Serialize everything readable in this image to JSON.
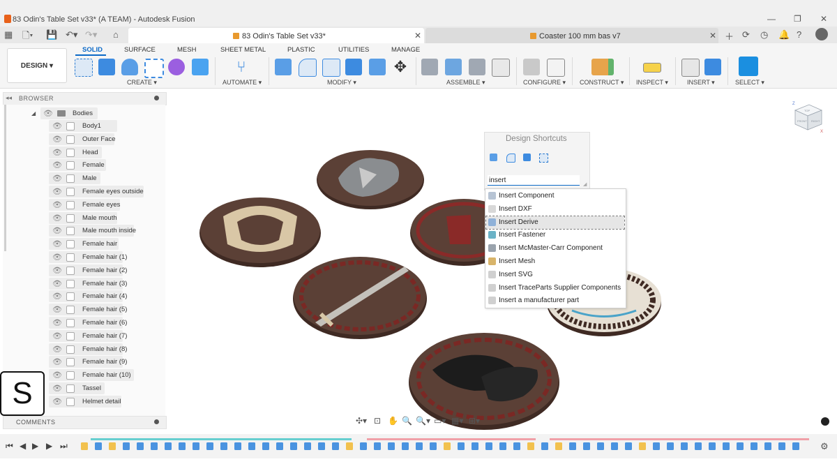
{
  "window": {
    "title": "83 Odin's Table Set v33* (A TEAM) - Autodesk Fusion"
  },
  "tabs": [
    {
      "label": "83 Odin's Table Set v33*",
      "active": true
    },
    {
      "label": "Coaster 100 mm bas v7",
      "active": false
    }
  ],
  "workspace": {
    "label": "DESIGN ▾"
  },
  "ribbon_tabs": [
    "SOLID",
    "SURFACE",
    "MESH",
    "SHEET METAL",
    "PLASTIC",
    "UTILITIES",
    "MANAGE"
  ],
  "ribbon_groups": [
    "CREATE ▾",
    "AUTOMATE ▾",
    "MODIFY ▾",
    "ASSEMBLE ▾",
    "CONFIGURE ▾",
    "CONSTRUCT ▾",
    "INSPECT ▾",
    "INSERT ▾",
    "SELECT ▾"
  ],
  "browser": {
    "header": "BROWSER",
    "folder": "Bodies",
    "items": [
      "Body1",
      "Outer Face",
      "Head",
      "Female",
      "Male",
      "Female eyes outside",
      "Female eyes",
      "Male mouth",
      "Male mouth inside",
      "Female hair",
      "Female hair (1)",
      "Female hair (2)",
      "Female hair (3)",
      "Female hair (4)",
      "Female hair (5)",
      "Female hair (6)",
      "Female hair (7)",
      "Female hair (8)",
      "Female hair (9)",
      "Female hair (10)",
      "Tassel",
      "Helmet detail"
    ]
  },
  "comments": {
    "header": "COMMENTS"
  },
  "shortcuts": {
    "title": "Design Shortcuts",
    "search_value": "insert",
    "results": [
      "Insert Component",
      "Insert DXF",
      "Insert Derive",
      "Insert Fastener",
      "Insert McMaster-Carr Component",
      "Insert Mesh",
      "Insert SVG",
      "Insert TraceParts Supplier Components",
      "Insert a manufacturer part"
    ],
    "highlighted": "Insert Derive"
  },
  "logo": {
    "letter": "S"
  },
  "viewcube": {
    "faces": [
      "TOP",
      "FRONT",
      "RIGHT"
    ],
    "axes": [
      "Z",
      "X"
    ]
  },
  "colors": {
    "accent": "#0b69c7",
    "coaster_wood": "#5b4036",
    "coaster_rim": "#3f2a23"
  }
}
